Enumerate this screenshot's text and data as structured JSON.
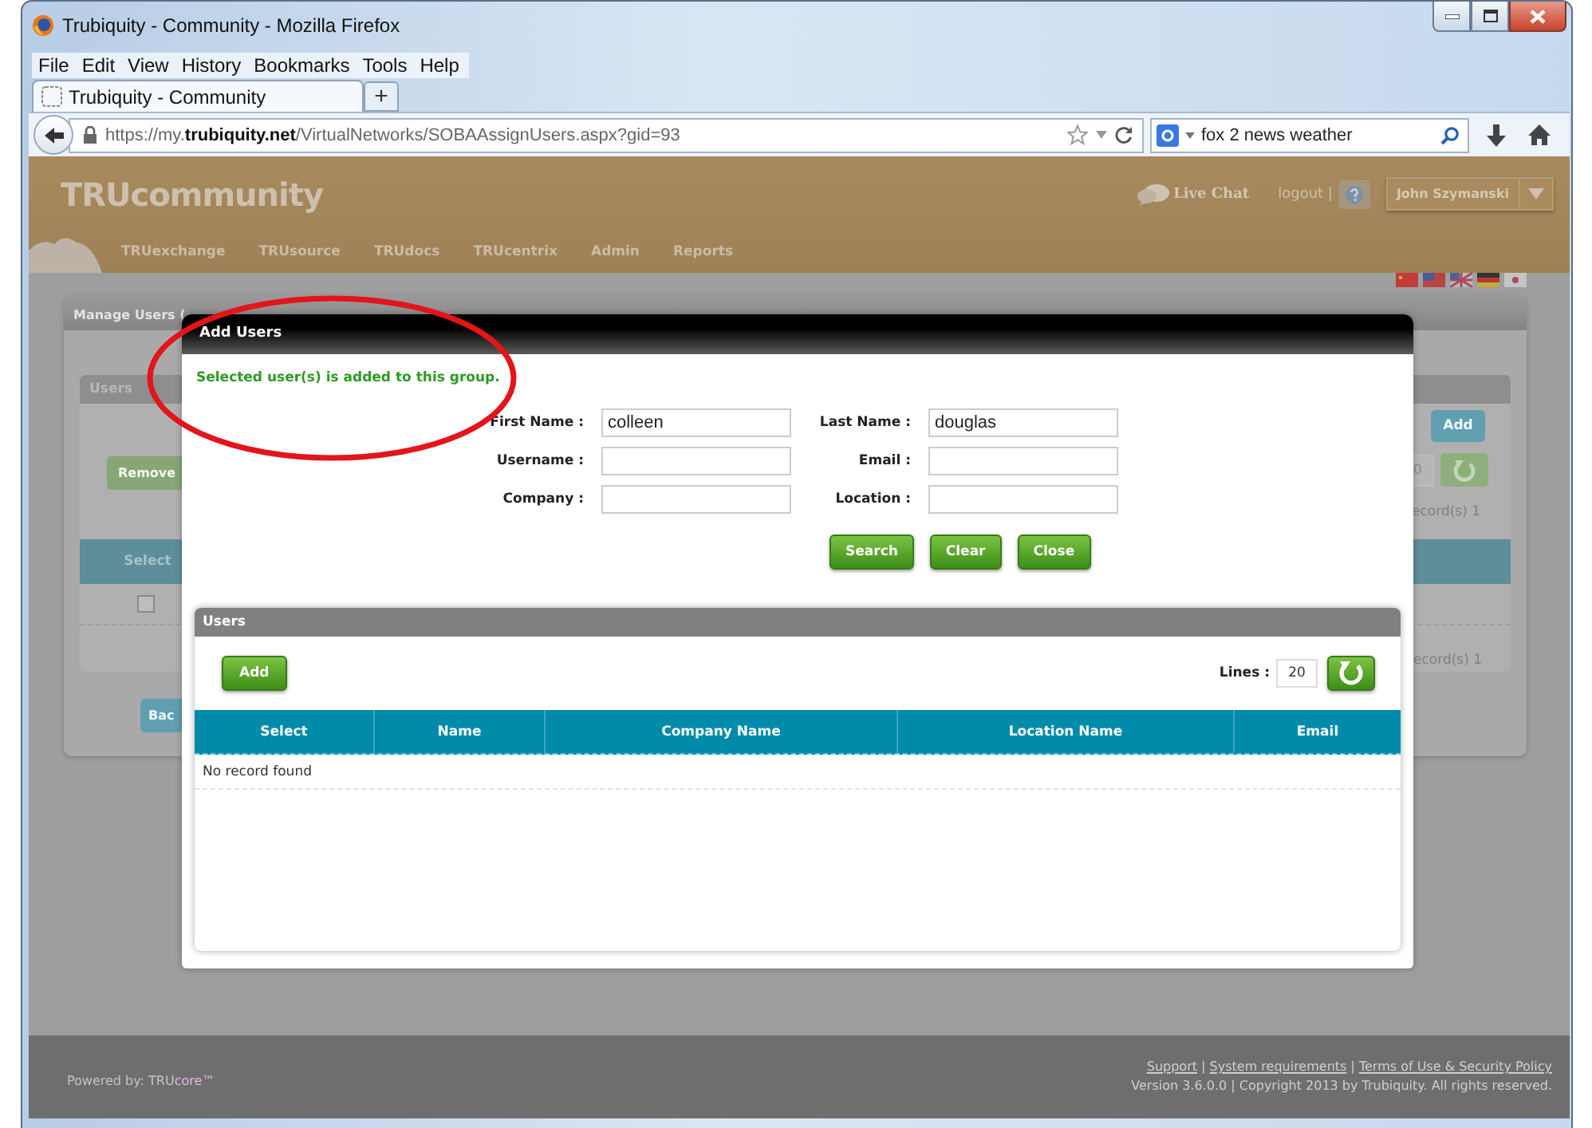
{
  "window": {
    "title": "Trubiquity - Community - Mozilla Firefox"
  },
  "menu": [
    "File",
    "Edit",
    "View",
    "History",
    "Bookmarks",
    "Tools",
    "Help"
  ],
  "tabs": [
    {
      "label": "Trubiquity - Community",
      "selected": true
    }
  ],
  "new_tab_label": "+",
  "address_bar": {
    "url": "https://my.**trubiquity.net**/VirtualNetworks/SOBAAssignUsers.aspx?gid=93"
  },
  "search_bar": {
    "value": "fox 2 news weather"
  },
  "site_header": {
    "logo": "TRUcommunity",
    "live_chat": "Live Chat",
    "logout": "logout |",
    "user": "John Szymanski"
  },
  "nav": [
    "TRUexchange",
    "TRUsource",
    "TRUdocs",
    "TRUcentrix",
    "Admin",
    "Reports"
  ],
  "background_page": {
    "panel_title": "Manage Users (",
    "users_title": "Users",
    "remove_button": "Remove",
    "add_button": "Add",
    "lines_value": "0",
    "records_top": "ecord(s) 1",
    "select_header": "Select",
    "row_checked": false,
    "records_bottom": "ecord(s) 1",
    "back_button": "Bac"
  },
  "dialog": {
    "title": "Add Users",
    "message": "Selected user(s) is added to this group.",
    "fields": [
      {
        "label": "First Name :",
        "value": "colleen"
      },
      {
        "label": "Last Name :",
        "value": "douglas"
      },
      {
        "label": "Username :"
      },
      {
        "label": "Email :"
      },
      {
        "label": "Company :"
      },
      {
        "label": "Location :"
      }
    ],
    "buttons": [
      "Search",
      "Clear",
      "Close"
    ],
    "users_panel": {
      "title": "Users",
      "add_button": "Add",
      "lines_label": "Lines :",
      "lines_value": "20",
      "columns": [
        "Select",
        "Name",
        "Company Name",
        "Location Name",
        "Email"
      ],
      "empty_message": "No record found"
    }
  },
  "footer": {
    "powered_label": "Powered by:",
    "brand": "TRU",
    "brand_accent": "core™",
    "links": [
      "Support",
      "System requirements",
      "Terms of Use & Security Policy"
    ],
    "separator": "|",
    "copyright": "Version 3.6.0.0 | Copyright 2013 by Trubiquity. All rights reserved."
  }
}
